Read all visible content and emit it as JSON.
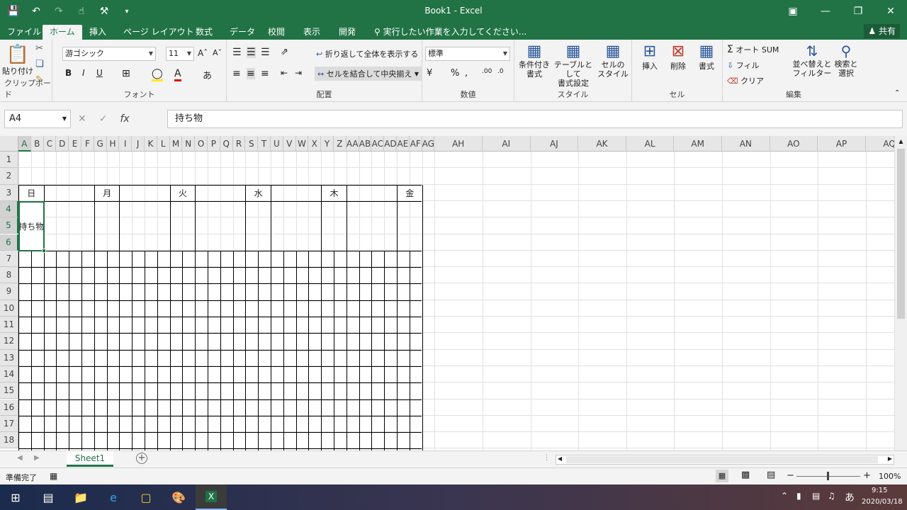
{
  "window": {
    "title": "Book1 - Excel"
  },
  "tabs": [
    "ファイル",
    "ホーム",
    "挿入",
    "ページ レイアウト",
    "数式",
    "データ",
    "校閲",
    "表示",
    "開発"
  ],
  "tell_me": "実行したい作業を入力してください...",
  "share": "共有",
  "ribbon": {
    "clipboard": {
      "label": "クリップボード",
      "paste": "貼り付け"
    },
    "font": {
      "label": "フォント",
      "name": "游ゴシック",
      "size": "11",
      "bold": "B",
      "italic": "I",
      "underline": "U"
    },
    "alignment": {
      "label": "配置",
      "wrap": "折り返して全体を表示する",
      "merge": "セルを結合して中央揃え"
    },
    "number": {
      "label": "数値",
      "format": "標準"
    },
    "styles": {
      "label": "スタイル",
      "conditional": "条件付き\n書式",
      "table": "テーブルとして\n書式設定",
      "cell": "セルの\nスタイル"
    },
    "cells": {
      "label": "セル",
      "insert": "挿入",
      "delete": "削除",
      "format": "書式"
    },
    "editing": {
      "label": "編集",
      "autosum": "オート SUM",
      "fill": "フィル",
      "clear": "クリア",
      "sort": "並べ替えと\nフィルター",
      "find": "検索と\n選択"
    }
  },
  "formula_bar": {
    "name_box": "A4",
    "content": "持ち物"
  },
  "columns_narrow": [
    "A",
    "B",
    "C",
    "D",
    "E",
    "F",
    "G",
    "H",
    "I",
    "J",
    "K",
    "L",
    "M",
    "N",
    "O",
    "P",
    "Q",
    "R",
    "S",
    "T",
    "U",
    "V",
    "W",
    "X",
    "Y",
    "Z",
    "AA",
    "AB",
    "AC",
    "AD",
    "AE",
    "AF",
    "AG"
  ],
  "columns_wide": [
    "AH",
    "AI",
    "AJ",
    "AK",
    "AL",
    "AM",
    "AN",
    "AO",
    "AP",
    "AQ"
  ],
  "rows": [
    "1",
    "2",
    "3",
    "4",
    "5",
    "6",
    "7",
    "8",
    "9",
    "10",
    "11",
    "12",
    "13",
    "14",
    "15",
    "16",
    "17",
    "18"
  ],
  "days": [
    "日",
    "月",
    "火",
    "水",
    "木",
    "金"
  ],
  "cell_a4": "持ち物",
  "sheet": {
    "tab": "Sheet1"
  },
  "status": {
    "ready": "準備完了",
    "zoom": "100%"
  },
  "taskbar": {
    "time": "9:15",
    "date": "2020/03/18",
    "ime": "あ"
  }
}
